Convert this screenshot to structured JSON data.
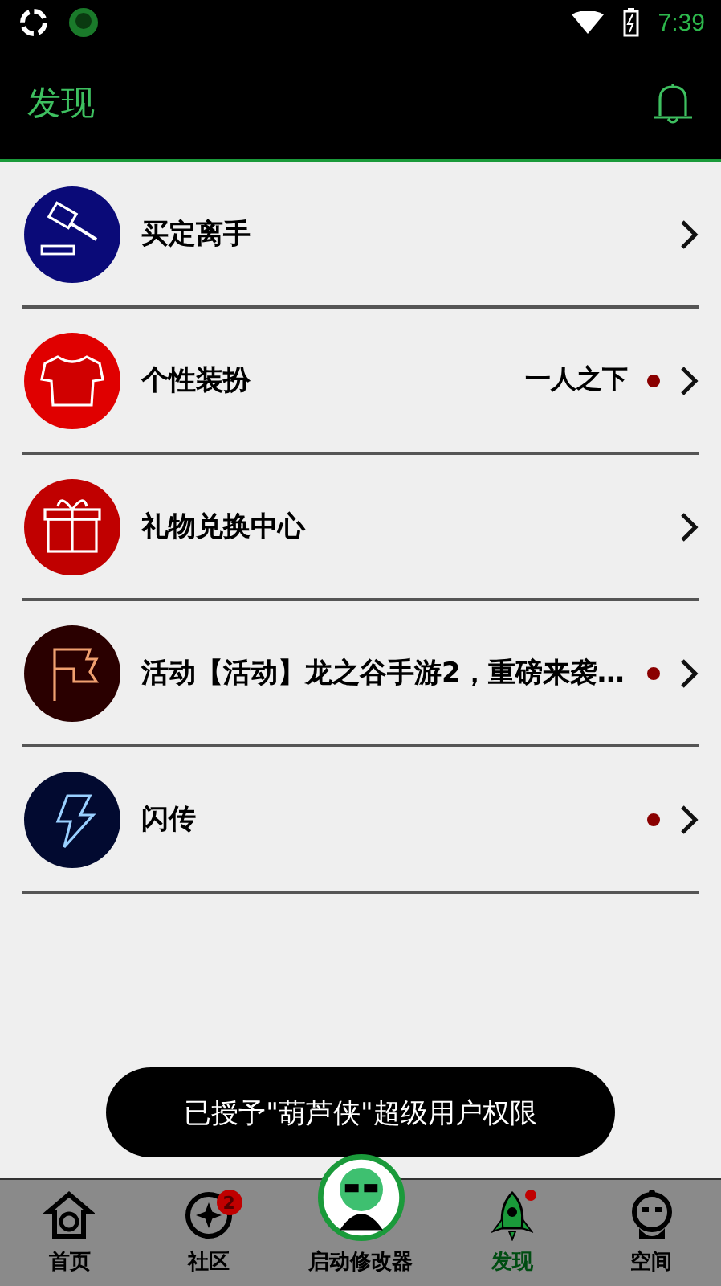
{
  "status_bar": {
    "time": "7:39"
  },
  "app_bar": {
    "title": "发现"
  },
  "items": [
    {
      "kind": "gavel",
      "color": "#0a0a78",
      "title": "买定离手",
      "dot": false
    },
    {
      "kind": "shirt",
      "color": "#e00000",
      "title": "个性装扮",
      "value": "一人之下",
      "dot": true
    },
    {
      "kind": "gift",
      "color": "#c00000",
      "title": "礼物兑换中心",
      "dot": false
    },
    {
      "kind": "flag",
      "color": "#2a0000",
      "title": "活动【活动】龙之谷手游2，重磅来袭…",
      "dot": true
    },
    {
      "kind": "bolt",
      "color": "#020a30",
      "title": "闪传",
      "dot": true
    }
  ],
  "toast": "已授予\"葫芦侠\"超级用户权限",
  "nav": [
    {
      "kind": "home",
      "label": "首页",
      "selected": false
    },
    {
      "kind": "community",
      "label": "社区",
      "selected": false,
      "badge": "2"
    },
    {
      "kind": "center",
      "label": "启动修改器",
      "selected": false
    },
    {
      "kind": "rocket",
      "label": "发现",
      "selected": true,
      "dot": true
    },
    {
      "kind": "face",
      "label": "空间",
      "selected": false
    }
  ]
}
